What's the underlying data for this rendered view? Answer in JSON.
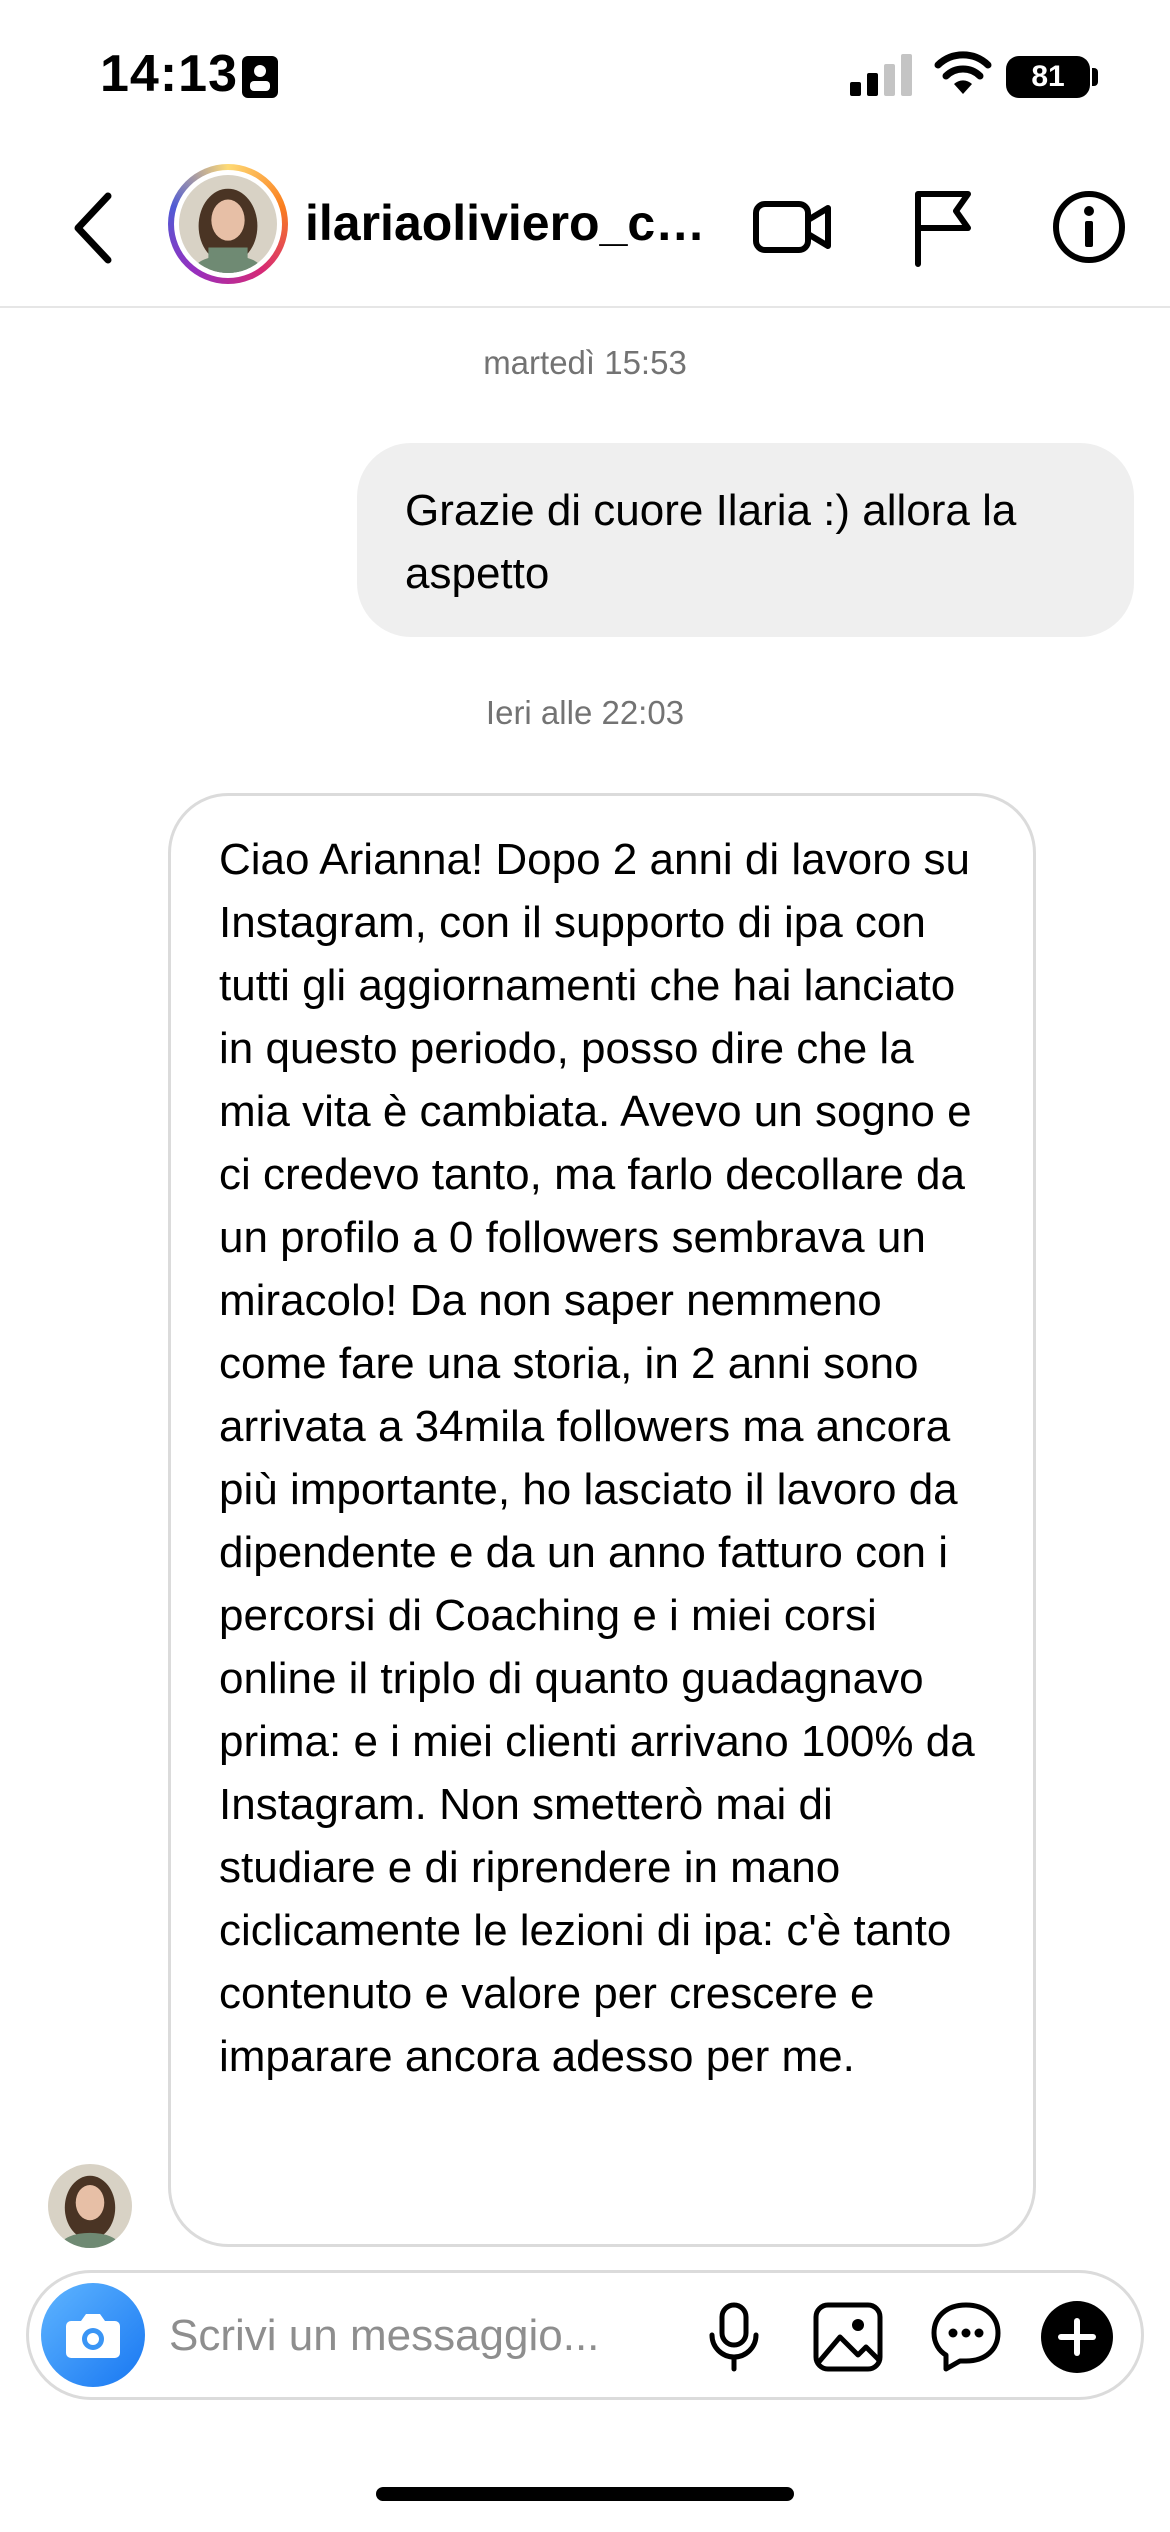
{
  "status_bar": {
    "time": "14:13",
    "battery": "81"
  },
  "header": {
    "username": "ilariaoliviero_co..."
  },
  "messages": {
    "timestamp_1": "martedì 15:53",
    "outgoing_1": "Grazie di cuore Ilaria :) allora la aspetto",
    "timestamp_2": "Ieri alle 22:03",
    "incoming_1": "Ciao Arianna! Dopo 2 anni di lavoro su Instagram, con il supporto di ipa con tutti gli aggiornamenti che hai lanciato in questo periodo, posso dire che la mia vita è cambiata. Avevo un sogno e ci credevo tanto, ma farlo decollare da un profilo a 0 followers sembrava un miracolo! Da non saper nemmeno come fare una storia, in 2 anni sono arrivata a 34mila followers ma ancora più importante, ho lasciato il lavoro da dipendente e da un anno fatturo con i percorsi di Coaching e i miei corsi online il triplo di quanto guadagnavo prima: e i miei clienti arrivano 100% da Instagram. Non smetterò mai di studiare e di riprendere in mano ciclicamente le lezioni di ipa: c'è tanto contenuto e valore per crescere e imparare ancora adesso per me."
  },
  "composer": {
    "placeholder": "Scrivi un messaggio..."
  },
  "icons": [
    "id-card-icon",
    "signal-icon",
    "wifi-icon",
    "back-chevron-icon",
    "video-call-icon",
    "flag-icon",
    "info-icon",
    "camera-icon",
    "microphone-icon",
    "gallery-icon",
    "sticker-chat-icon",
    "plus-icon"
  ],
  "colors": {
    "outgoing_bubble": "#efefef",
    "camera_button": "#1877f2",
    "timestamp_text": "#737373"
  }
}
